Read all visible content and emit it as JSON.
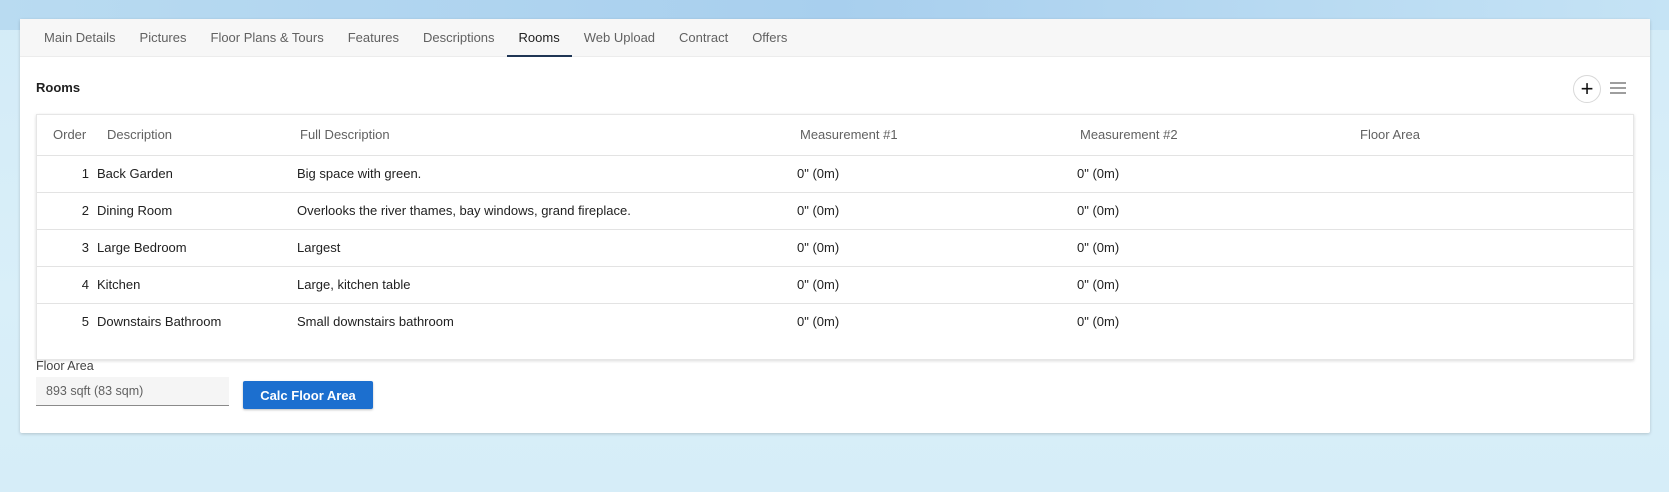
{
  "tabs": [
    {
      "label": "Main Details"
    },
    {
      "label": "Pictures"
    },
    {
      "label": "Floor Plans & Tours"
    },
    {
      "label": "Features"
    },
    {
      "label": "Descriptions"
    },
    {
      "label": "Rooms"
    },
    {
      "label": "Web Upload"
    },
    {
      "label": "Contract"
    },
    {
      "label": "Offers"
    }
  ],
  "active_tab": "Rooms",
  "section": {
    "title": "Rooms",
    "add_icon": "plus-icon",
    "menu_icon": "hamburger-menu-icon"
  },
  "table": {
    "headers": {
      "order": "Order",
      "description": "Description",
      "full_description": "Full Description",
      "measurement1": "Measurement #1",
      "measurement2": "Measurement #2",
      "floor_area": "Floor Area"
    },
    "rows": [
      {
        "order": "1",
        "description": "Back Garden",
        "full_description": "Big space with green.",
        "measurement1": "0\" (0m)",
        "measurement2": "0\" (0m)",
        "floor_area": ""
      },
      {
        "order": "2",
        "description": "Dining Room",
        "full_description": "Overlooks the river thames, bay windows, grand fireplace.",
        "measurement1": "0\" (0m)",
        "measurement2": "0\" (0m)",
        "floor_area": ""
      },
      {
        "order": "3",
        "description": "Large Bedroom",
        "full_description": "Largest",
        "measurement1": "0\" (0m)",
        "measurement2": "0\" (0m)",
        "floor_area": ""
      },
      {
        "order": "4",
        "description": "Kitchen",
        "full_description": "Large, kitchen table",
        "measurement1": "0\" (0m)",
        "measurement2": "0\" (0m)",
        "floor_area": ""
      },
      {
        "order": "5",
        "description": "Downstairs Bathroom",
        "full_description": "Small downstairs bathroom",
        "measurement1": "0\" (0m)",
        "measurement2": "0\" (0m)",
        "floor_area": ""
      }
    ]
  },
  "floor_area": {
    "label": "Floor Area",
    "value": "893 sqft (83 sqm)",
    "button_label": "Calc Floor Area"
  },
  "colors": {
    "accent": "#1c6fcf",
    "tab_underline": "#1f3554"
  }
}
